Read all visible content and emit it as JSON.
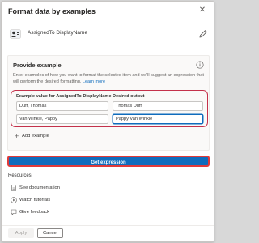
{
  "dialog": {
    "title": "Format data by examples",
    "close_glyph": "✕"
  },
  "column": {
    "name": "AssignedTo DisplayName",
    "icon": "person-field-icon"
  },
  "provide_example": {
    "title": "Provide example",
    "description": "Enter examples of how you want to format the selected item and we'll suggest an expression that will perform the desired formatting.",
    "learn_more": "Learn more",
    "header_input": "Example value for AssignedTo DisplayName",
    "header_output": "Desired output",
    "rows": [
      {
        "input": "Duff, Thomas",
        "output": "Thomas Duff"
      },
      {
        "input": "Van Winkle, Pappy",
        "output": "Pappy Van Winkle"
      }
    ],
    "add_example": "Add example"
  },
  "get_expression_label": "Get expression",
  "resources": {
    "title": "Resources",
    "items": [
      {
        "label": "See documentation",
        "icon": "document-icon"
      },
      {
        "label": "Watch tutorials",
        "icon": "play-icon"
      },
      {
        "label": "Give feedback",
        "icon": "feedback-icon"
      }
    ]
  },
  "footer": {
    "apply_label": "Apply",
    "cancel_label": "Cancel"
  },
  "colors": {
    "accent": "#0f6cbd",
    "highlight": "#c4314b"
  }
}
